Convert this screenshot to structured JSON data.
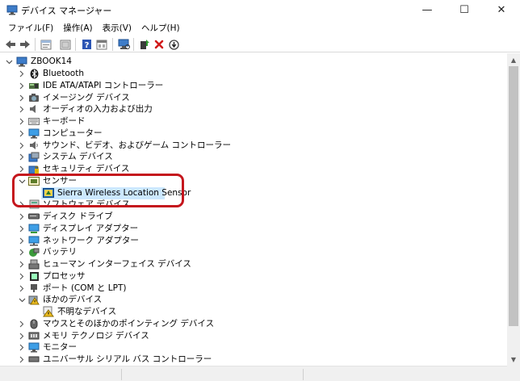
{
  "window": {
    "title": "デバイス マネージャー",
    "buttons": {
      "minimize": "—",
      "maximize": "☐",
      "close": "✕"
    }
  },
  "menu": [
    "ファイル(F)",
    "操作(A)",
    "表示(V)",
    "ヘルプ(H)"
  ],
  "toolbar": [
    "back-arrow-icon",
    "forward-arrow-icon",
    "properties-icon",
    "show-hide-icon",
    "help-icon",
    "view-icon",
    "scan-hardware-icon",
    "update-driver-icon",
    "uninstall-icon",
    "disable-icon"
  ],
  "tree": {
    "root": "ZBOOK14",
    "categories": [
      "Bluetooth",
      "IDE ATA/ATAPI コントローラー",
      "イメージング デバイス",
      "オーディオの入力および出力",
      "キーボード",
      "コンピューター",
      "サウンド、ビデオ、およびゲーム コントローラー",
      "システム デバイス",
      "セキュリティ デバイス",
      "センサー",
      "ソフトウェア デバイス",
      "ディスク ドライブ",
      "ディスプレイ アダプター",
      "ネットワーク アダプター",
      "バッテリ",
      "ヒューマン インターフェイス デバイス",
      "プロセッサ",
      "ポート (COM と LPT)",
      "ほかのデバイス",
      "マウスとそのほかのポインティング デバイス",
      "メモリ テクノロジ デバイス",
      "モニター",
      "ユニバーサル シリアル バス コントローラー"
    ],
    "sensor_child": "Sierra Wireless Location Sensor",
    "other_child": "不明なデバイス"
  },
  "colors": {
    "selection": "#cce8ff",
    "highlight": "#c5161d"
  }
}
